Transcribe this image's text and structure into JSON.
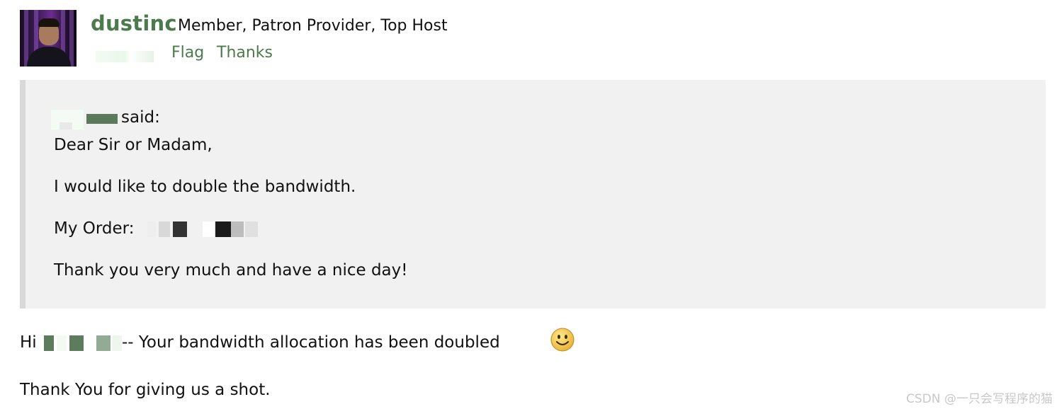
{
  "post": {
    "username": "dustinc",
    "roles": "Member, Patron Provider, Top Host",
    "actions": {
      "flag": "Flag",
      "thanks": "Thanks"
    },
    "avatar_icon": "user-avatar-photo"
  },
  "quote": {
    "said_label": "said:",
    "greeting": "Dear Sir or Madam,",
    "request": "I would like to double the bandwidth.",
    "order_label": "My Order:",
    "closing": "Thank you very much and have a nice day!"
  },
  "reply": {
    "hi": "Hi",
    "message": "-- Your bandwidth allocation has been doubled",
    "thanks": "Thank You for giving us a shot.",
    "emoji_icon": "smiley-face-icon"
  },
  "watermark": "CSDN @一只会写程序的猫",
  "colors": {
    "link_green": "#4c7a4c",
    "quote_bg": "#f1f1f1",
    "quote_border": "#d9d9d9",
    "text": "#111111"
  }
}
